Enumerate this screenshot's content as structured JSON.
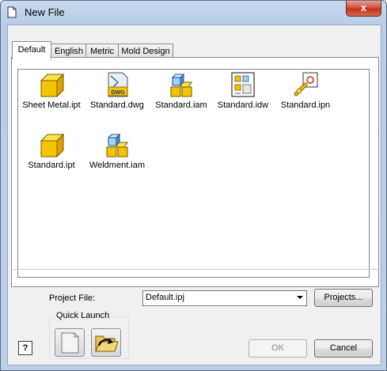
{
  "window": {
    "title": "New File",
    "close_label": "x"
  },
  "tabs": [
    {
      "label": "Default",
      "active": true
    },
    {
      "label": "English",
      "active": false
    },
    {
      "label": "Metric",
      "active": false
    },
    {
      "label": "Mold Design",
      "active": false
    }
  ],
  "files": [
    {
      "label": "Sheet Metal.ipt",
      "icon": "part-icon"
    },
    {
      "label": "Standard.dwg",
      "icon": "dwg-icon"
    },
    {
      "label": "Standard.iam",
      "icon": "assembly-icon"
    },
    {
      "label": "Standard.idw",
      "icon": "drawing-icon"
    },
    {
      "label": "Standard.ipn",
      "icon": "presentation-icon"
    },
    {
      "label": "Standard.ipt",
      "icon": "part-icon"
    },
    {
      "label": "Weldment.iam",
      "icon": "assembly-icon"
    }
  ],
  "dwg_badge": "DWG",
  "project": {
    "label": "Project File:",
    "value": "Default.ipj",
    "projects_button": "Projects..."
  },
  "quick_launch": {
    "title": "Quick Launch"
  },
  "help": {
    "label": "?"
  },
  "buttons": {
    "ok": "OK",
    "cancel": "Cancel"
  },
  "colors": {
    "cube_yellow": "#f5c400",
    "title_bar": "#bcd0e9",
    "close_red": "#c7432c"
  }
}
